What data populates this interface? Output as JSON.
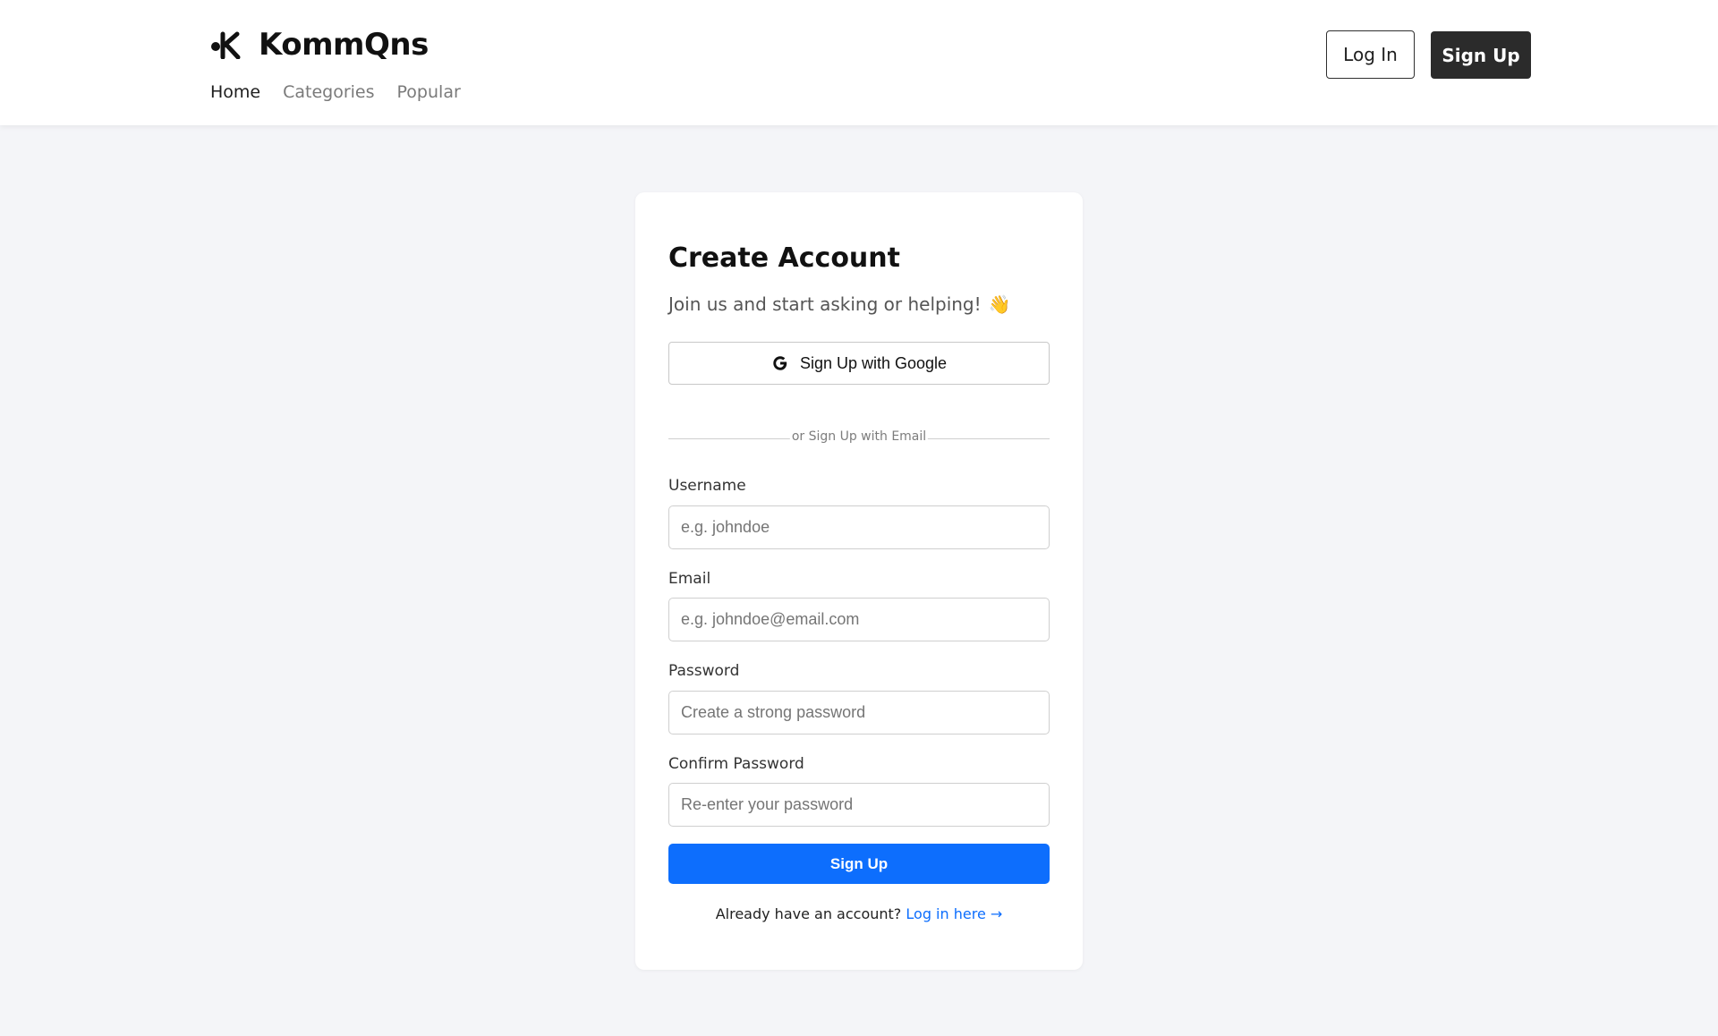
{
  "header": {
    "brand": "KommQns",
    "nav": [
      "Home",
      "Categories",
      "Popular"
    ],
    "active_nav": "Home",
    "login_label": "Log In",
    "signup_label": "Sign Up"
  },
  "form": {
    "title": "Create Account",
    "subtitle": "Join us and start asking or helping!",
    "subtitle_emoji": "👋",
    "google_label": "Sign Up with Google",
    "divider_text": "or Sign Up with Email",
    "username_label": "Username",
    "username_placeholder": "e.g. johndoe",
    "email_label": "Email",
    "email_placeholder": "e.g. johndoe@email.com",
    "password_label": "Password",
    "password_placeholder": "Create a strong password",
    "confirm_label": "Confirm Password",
    "confirm_placeholder": "Re-enter your password",
    "submit_label": "Sign Up",
    "footer_text": "Already have an account?",
    "footer_link": "Log in here →"
  },
  "colors": {
    "background": "#f4f5f8",
    "primary": "#0d6efd",
    "dark_button": "#2b2b2b"
  }
}
